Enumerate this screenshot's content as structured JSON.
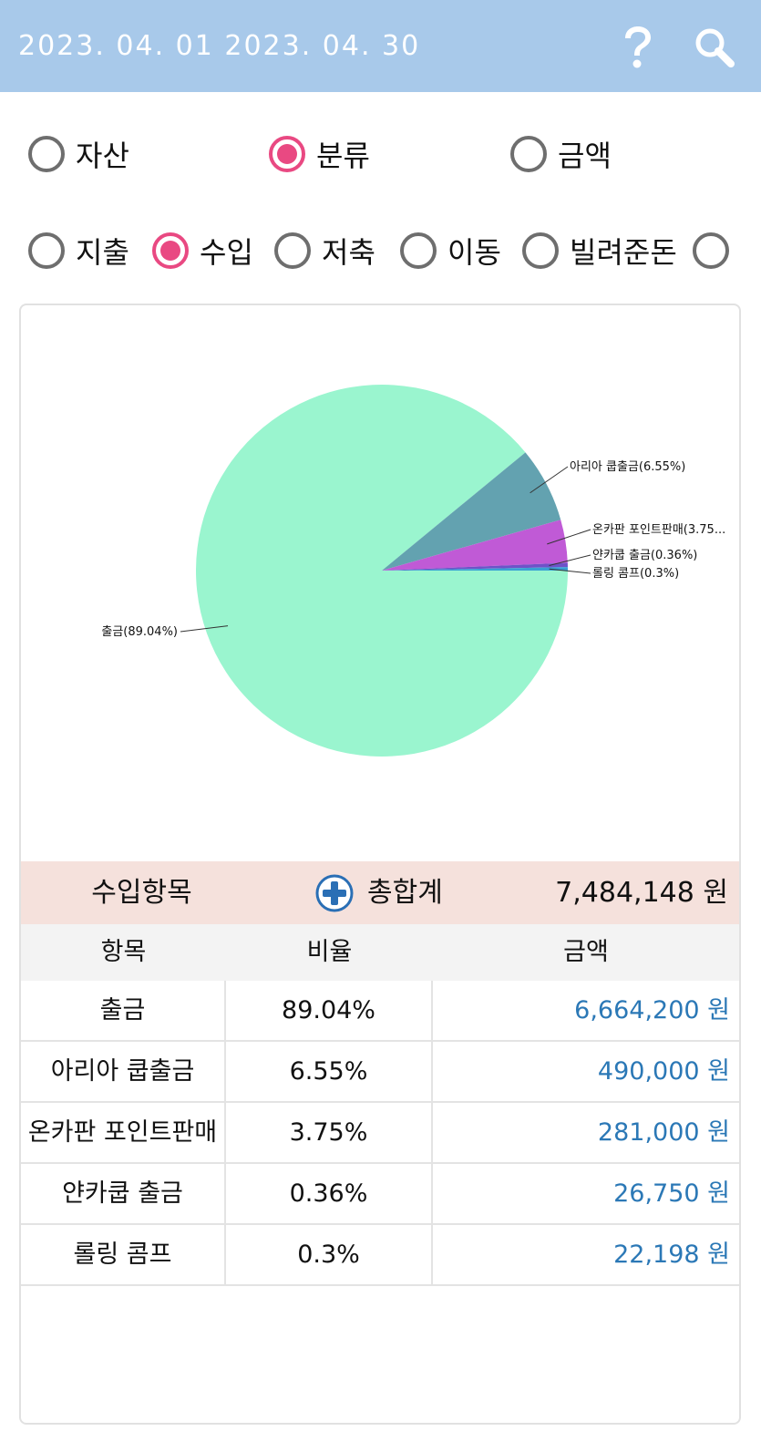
{
  "header": {
    "date_range": "2023. 04. 01 2023. 04. 30",
    "bg_color": "#a8c9ea",
    "help_icon": "question-mark-icon",
    "search_icon": "magnifier-icon"
  },
  "group_by": {
    "options": [
      {
        "label": "자산",
        "checked": false
      },
      {
        "label": "분류",
        "checked": true
      },
      {
        "label": "금액",
        "checked": false
      }
    ]
  },
  "type_filter": {
    "options": [
      {
        "label": "지출",
        "checked": false
      },
      {
        "label": "수입",
        "checked": true
      },
      {
        "label": "저축",
        "checked": false
      },
      {
        "label": "이동",
        "checked": false
      },
      {
        "label": "빌려준돈",
        "checked": false
      },
      {
        "label": "",
        "checked": false
      }
    ]
  },
  "accent_color": "#e94982",
  "chart_data": {
    "type": "pie",
    "slices": [
      {
        "label": "출금(89.04%)",
        "value": 89.04,
        "color": "#9af5cf"
      },
      {
        "label": "아리아 쿱출금(6.55%)",
        "value": 6.55,
        "color": "#63a2b0"
      },
      {
        "label": "온카판 포인트판매(3.75...",
        "value": 3.75,
        "color": "#c05ad6"
      },
      {
        "label": "얀카쿱 출금(0.36%)",
        "value": 0.36,
        "color": "#6f52c8"
      },
      {
        "label": "롤링 콤프(0.3%)",
        "value": 0.3,
        "color": "#3aa0d4"
      }
    ]
  },
  "summary": {
    "title": "수입항목",
    "add_icon": "plus-circle-icon",
    "total_label": "총합계",
    "total_value": "7,484,148 원"
  },
  "table": {
    "headers": [
      "항목",
      "비율",
      "금액"
    ],
    "rows": [
      {
        "name": "출금",
        "ratio": "89.04%",
        "amount": "6,664,200 원"
      },
      {
        "name": "아리아 쿱출금",
        "ratio": "6.55%",
        "amount": "490,000 원"
      },
      {
        "name": "온카판 포인트판매",
        "ratio": "3.75%",
        "amount": "281,000 원"
      },
      {
        "name": "얀카쿱 출금",
        "ratio": "0.36%",
        "amount": "26,750 원"
      },
      {
        "name": "롤링 콤프",
        "ratio": "0.3%",
        "amount": "22,198 원"
      }
    ],
    "amount_color": "#2b78b6"
  }
}
